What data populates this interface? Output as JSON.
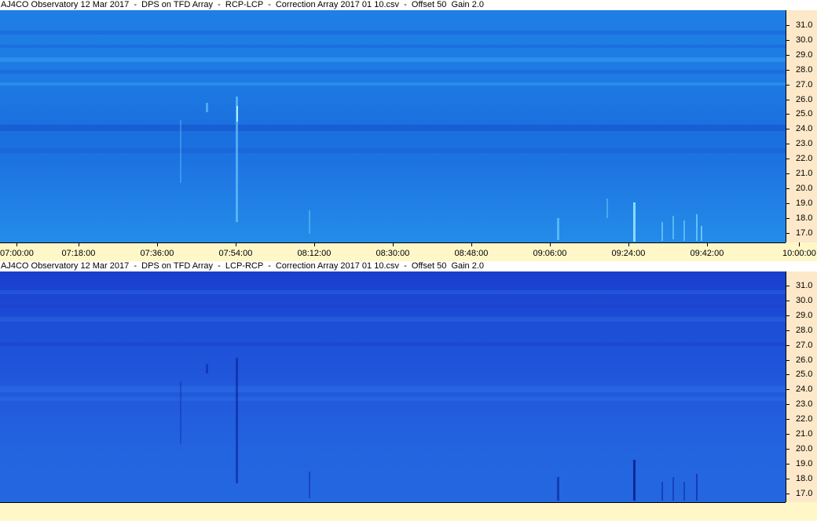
{
  "panels": [
    {
      "title": "AJ4CO Observatory 12 Mar 2017  -  DPS on TFD Array  -  RCP-LCP  -  Correction Array 2017 01 10.csv  -  Offset 50  Gain 2.0",
      "freq_ticks": [
        "31.0",
        "30.0",
        "29.0",
        "28.0",
        "27.0",
        "26.0",
        "25.0",
        "24.0",
        "23.0",
        "22.0",
        "21.0",
        "20.0",
        "19.0",
        "18.0",
        "17.0"
      ],
      "time_ticks": [
        "07:00:00",
        "07:18:00",
        "07:36:00",
        "07:54:00",
        "08:12:00",
        "08:30:00",
        "08:48:00",
        "09:06:00",
        "09:24:00",
        "09:42:00",
        "10:00:00"
      ],
      "colors": {
        "burst": "#8fe6ff",
        "band": "#1559d2"
      }
    },
    {
      "title": "AJ4CO Observatory 12 Mar 2017  -  DPS on TFD Array  -  LCP-RCP  -  Correction Array 2017 01 10.csv  -  Offset 50  Gain 2.0",
      "freq_ticks": [
        "31.0",
        "30.0",
        "29.0",
        "28.0",
        "27.0",
        "26.0",
        "25.0",
        "24.0",
        "23.0",
        "22.0",
        "21.0",
        "20.0",
        "19.0",
        "18.0",
        "17.0"
      ],
      "time_ticks": [],
      "colors": {
        "burst": "#0d2aa8",
        "band": "#1a3cc8"
      }
    }
  ]
}
